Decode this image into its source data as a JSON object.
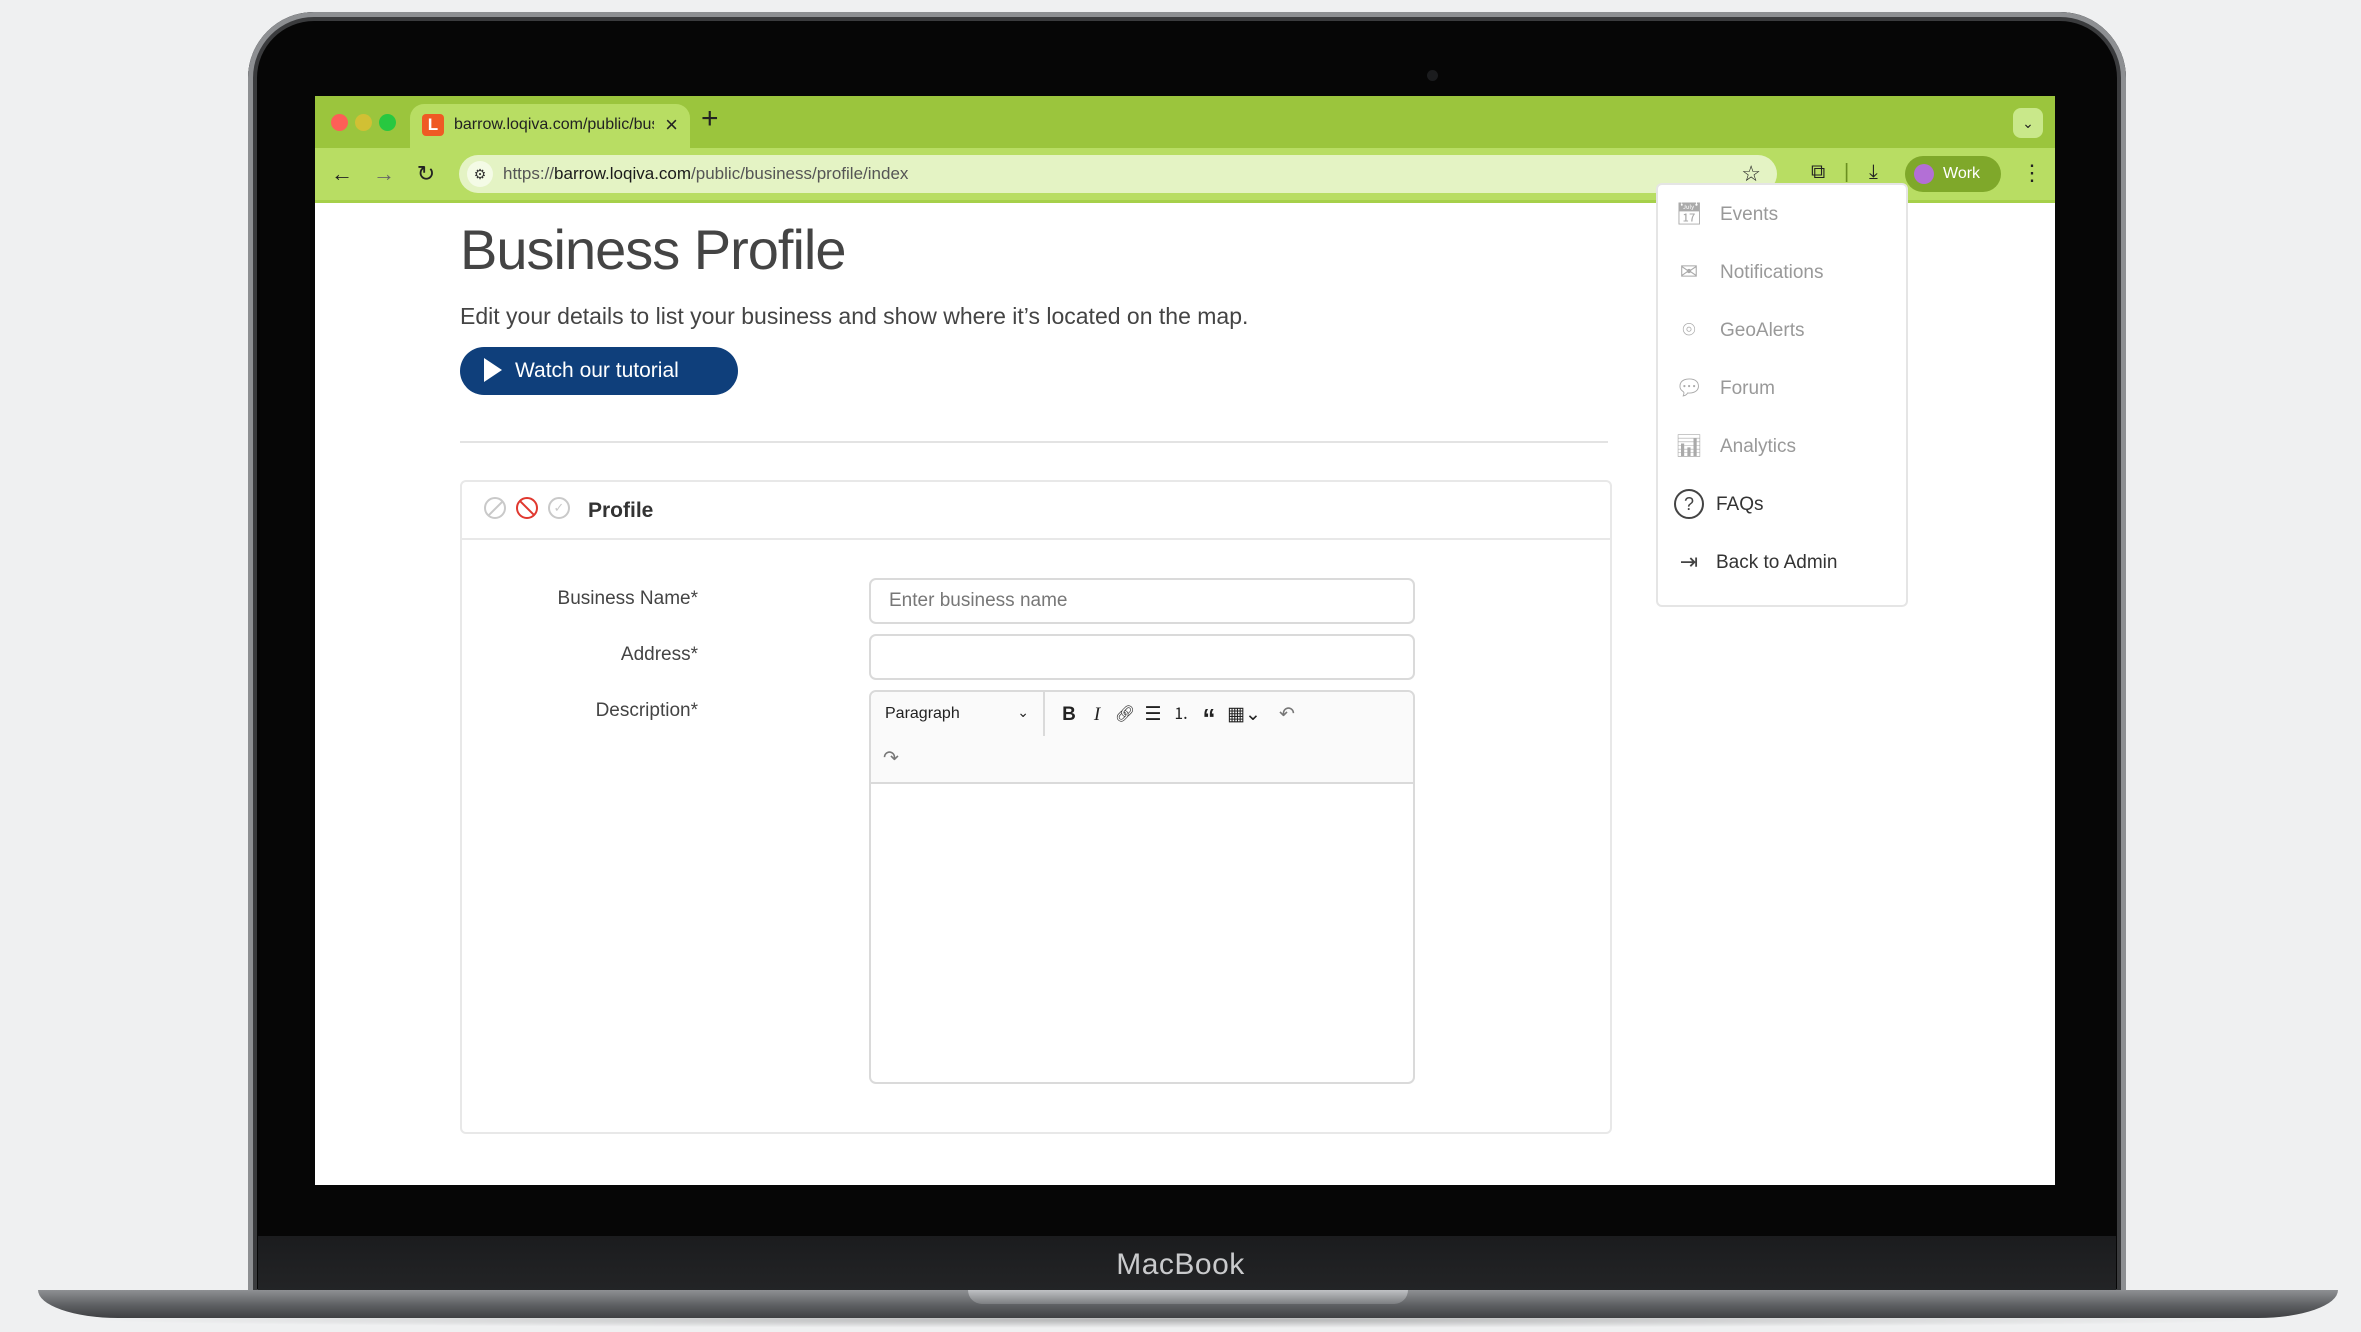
{
  "device": {
    "brand": "MacBook"
  },
  "browser": {
    "tab": {
      "title": "barrow.loqiva.com/public/bus",
      "favicon_letter": "L"
    },
    "url_prefix": "https://",
    "url_host": "barrow.loqiva.com",
    "url_path": "/public/business/profile/index",
    "profile_label": "Work",
    "accent_color": "#9bc53d"
  },
  "page": {
    "title": "Business Profile",
    "subtitle": "Edit your details to list your business and show where it’s located on the map.",
    "tutorial_button": "Watch our tutorial"
  },
  "card": {
    "title": "Profile",
    "status_icons": [
      "none-icon",
      "error-icon",
      "check-icon"
    ]
  },
  "form": {
    "business_name_label": "Business Name*",
    "business_name_placeholder": "Enter business name",
    "business_name_value": "",
    "address_label": "Address*",
    "address_value": "",
    "description_label": "Description*",
    "editor": {
      "block_format": "Paragraph",
      "tools": [
        "bold",
        "italic",
        "link",
        "bulleted-list",
        "numbered-list",
        "blockquote",
        "table",
        "undo",
        "redo"
      ]
    }
  },
  "sidebar": {
    "items": [
      {
        "label": "Events",
        "icon": "calendar-icon",
        "active": false
      },
      {
        "label": "Notifications",
        "icon": "envelope-icon",
        "active": false
      },
      {
        "label": "GeoAlerts",
        "icon": "map-pin-icon",
        "active": false
      },
      {
        "label": "Forum",
        "icon": "chat-icon",
        "active": false
      },
      {
        "label": "Analytics",
        "icon": "bar-chart-icon",
        "active": false
      },
      {
        "label": "FAQs",
        "icon": "question-icon",
        "active": true
      },
      {
        "label": "Back to Admin",
        "icon": "exit-icon",
        "active": true
      }
    ]
  },
  "colors": {
    "primary_button": "#0f3f7b",
    "error": "#e0382f"
  }
}
